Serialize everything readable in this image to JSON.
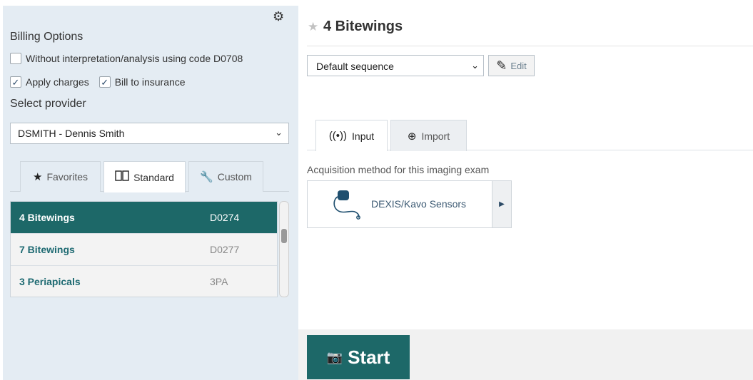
{
  "left_panel": {
    "billing_title": "Billing Options",
    "option_d0708": {
      "label": "Without interpretation/analysis using code D0708",
      "checked": false
    },
    "option_charges": {
      "label": "Apply charges",
      "checked": true
    },
    "option_insurance": {
      "label": "Bill to insurance",
      "checked": true
    },
    "provider_label": "Select provider",
    "provider_value": "DSMITH - Dennis Smith",
    "library_tabs": {
      "favorites": "Favorites",
      "standard": "Standard",
      "custom": "Custom",
      "active": "standard"
    },
    "exams": [
      {
        "name": "4 Bitewings",
        "code": "D0274",
        "selected": true
      },
      {
        "name": "7 Bitewings",
        "code": "D0277",
        "selected": false
      },
      {
        "name": "3 Periapicals",
        "code": "3PA",
        "selected": false
      }
    ]
  },
  "main": {
    "exam_title": "4 Bitewings",
    "favorite": false,
    "sequence_value": "Default sequence",
    "edit_label": "Edit",
    "source_tabs": {
      "input": "Input",
      "import": "Import",
      "active": "input"
    },
    "acquisition_label": "Acquisition method for this imaging exam",
    "device_name": "DEXIS/Kavo Sensors",
    "start_label": "Start"
  },
  "colors": {
    "accent": "#1d6868",
    "panel_bg": "#e4ecf3",
    "link_text": "#1e6a72"
  },
  "icons": {
    "settings": "gear-icon",
    "favorites_tab": "star-icon",
    "standard_tab": "book-icon",
    "custom_tab": "wrench-icon",
    "edit": "pencil-icon",
    "input_tab": "wireless-signal-icon",
    "import_tab": "plus-circle-icon",
    "device": "sensor-cable-icon",
    "start": "camera-icon"
  }
}
